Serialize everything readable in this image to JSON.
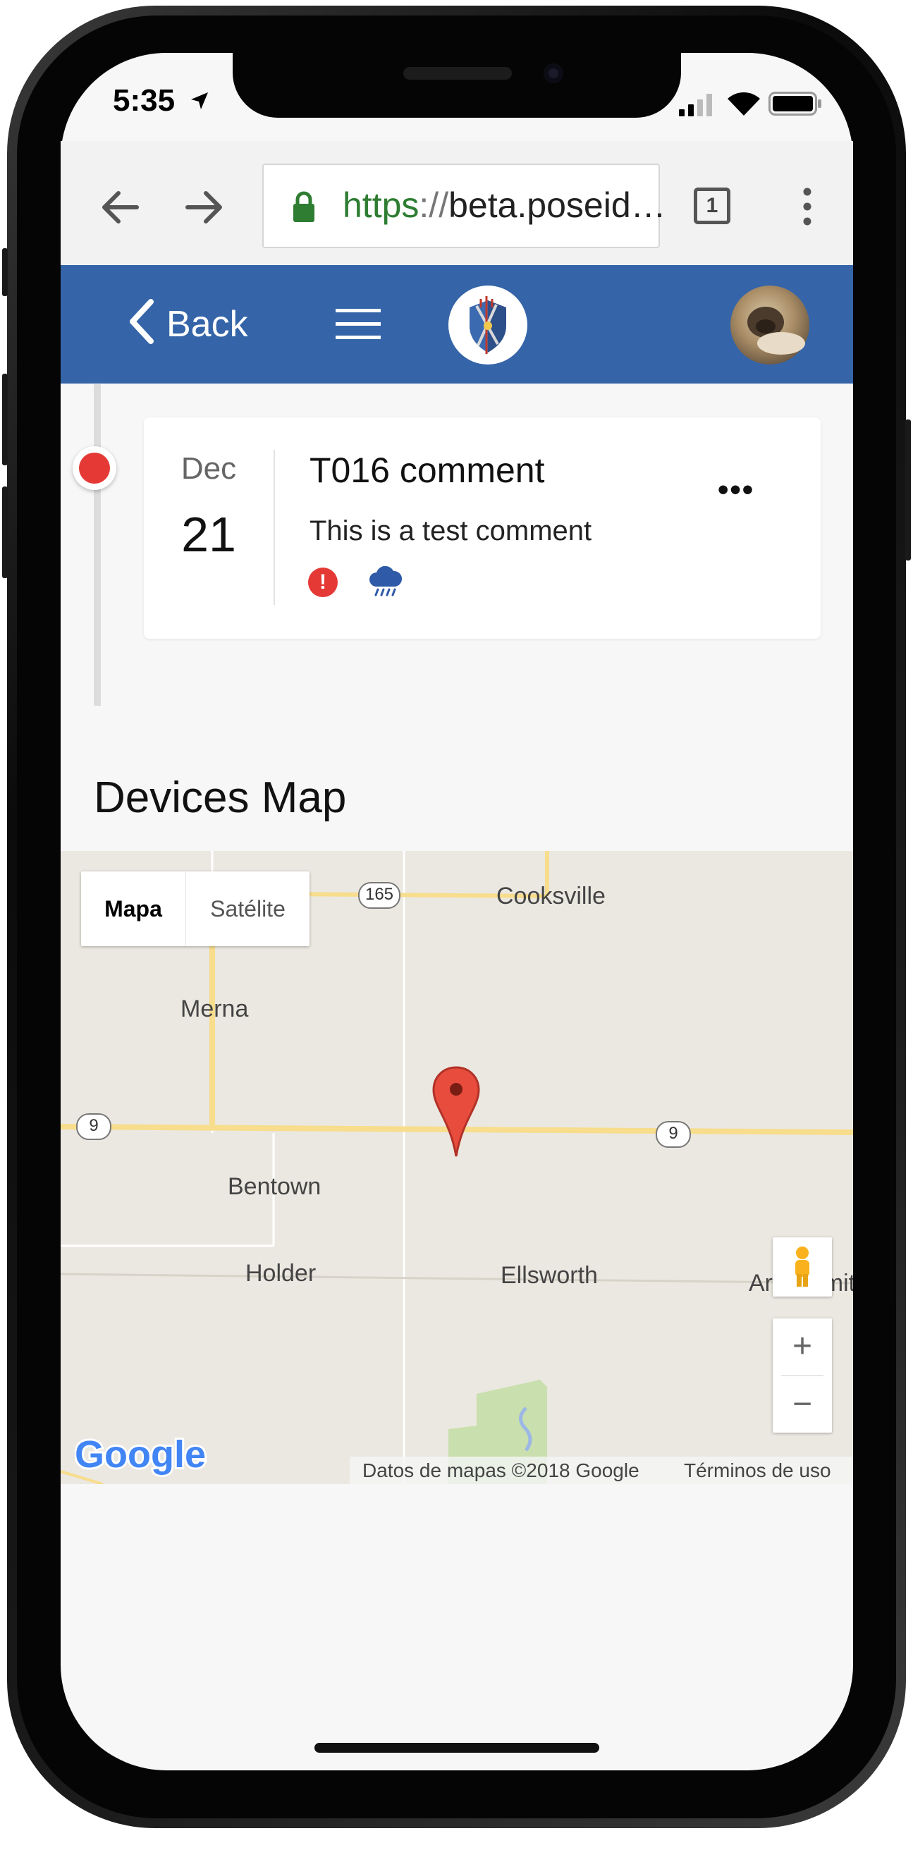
{
  "status_bar": {
    "time": "5:35"
  },
  "browser": {
    "url_scheme": "https",
    "url_separator": "://",
    "url_host": "beta.poseid…",
    "tab_count": "1"
  },
  "header": {
    "back_label": "Back"
  },
  "timeline": {
    "entries": [
      {
        "month": "Dec",
        "day": "21",
        "title": "T016 comment",
        "body": "This is a test comment",
        "alert_glyph": "!",
        "more_label": "•••",
        "icons": [
          "alert-icon",
          "rain-cloud-icon"
        ]
      }
    ]
  },
  "map_section": {
    "title": "Devices Map",
    "map_type": {
      "map": "Mapa",
      "satellite": "Satélite",
      "selected": "Mapa"
    },
    "places": {
      "cooksville": "Cooksville",
      "merna": "Merna",
      "bentown": "Bentown",
      "holder": "Holder",
      "ellsworth": "Ellsworth",
      "arrowsmith": "Arrowsmith"
    },
    "routes": {
      "r165": "165",
      "r9_west": "9",
      "r9_east": "9"
    },
    "zoom_in": "+",
    "zoom_out": "−",
    "logo_text": "Google",
    "attribution": "Datos de mapas ©2018 Google",
    "terms": "Términos de uso"
  },
  "colors": {
    "header_blue": "#3565a8",
    "alert_red": "#e53935",
    "https_green": "#2e7d32",
    "map_background": "#ebe8e1",
    "road_yellow": "#f7dd8c"
  }
}
